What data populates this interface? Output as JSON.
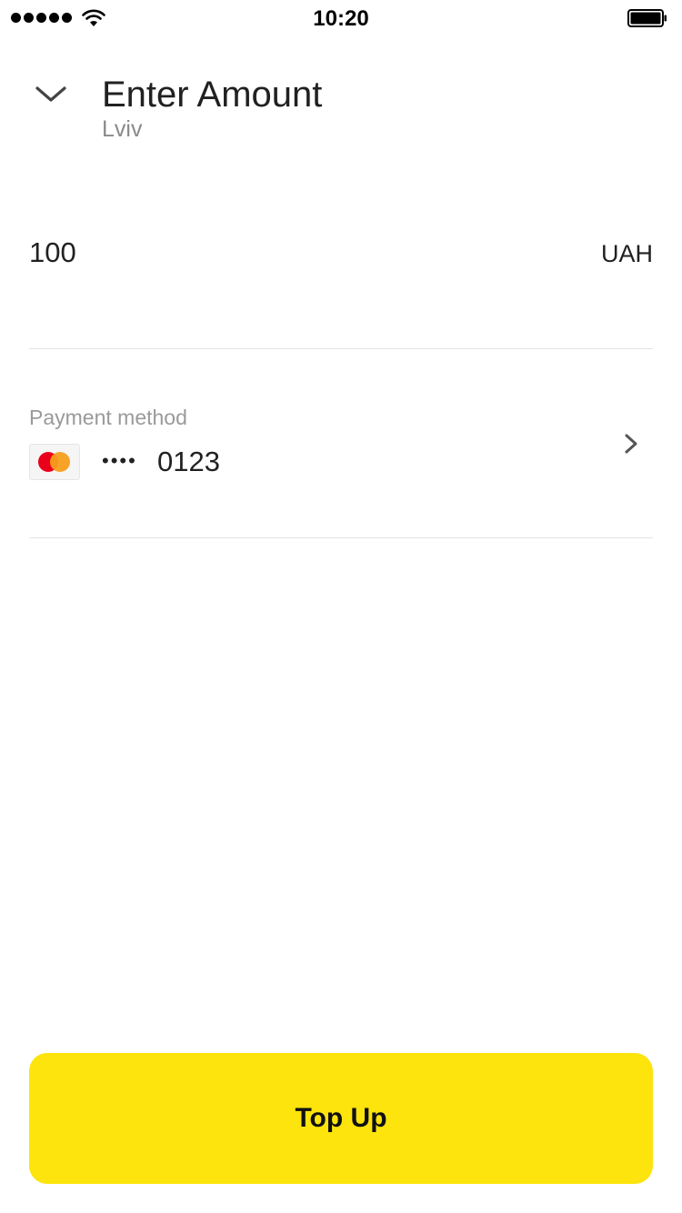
{
  "status_bar": {
    "time": "10:20"
  },
  "header": {
    "title": "Enter Amount",
    "subtitle": "Lviv"
  },
  "amount": {
    "value": "100",
    "currency": "UAH"
  },
  "payment": {
    "label": "Payment method",
    "card_masked": "••••",
    "card_last4": "0123",
    "card_brand_icon": "mastercard-icon"
  },
  "topup_label": "Top Up",
  "colors": {
    "accent": "#fce40c",
    "mastercard_red": "#eb001b",
    "mastercard_orange": "#f79e1b"
  }
}
